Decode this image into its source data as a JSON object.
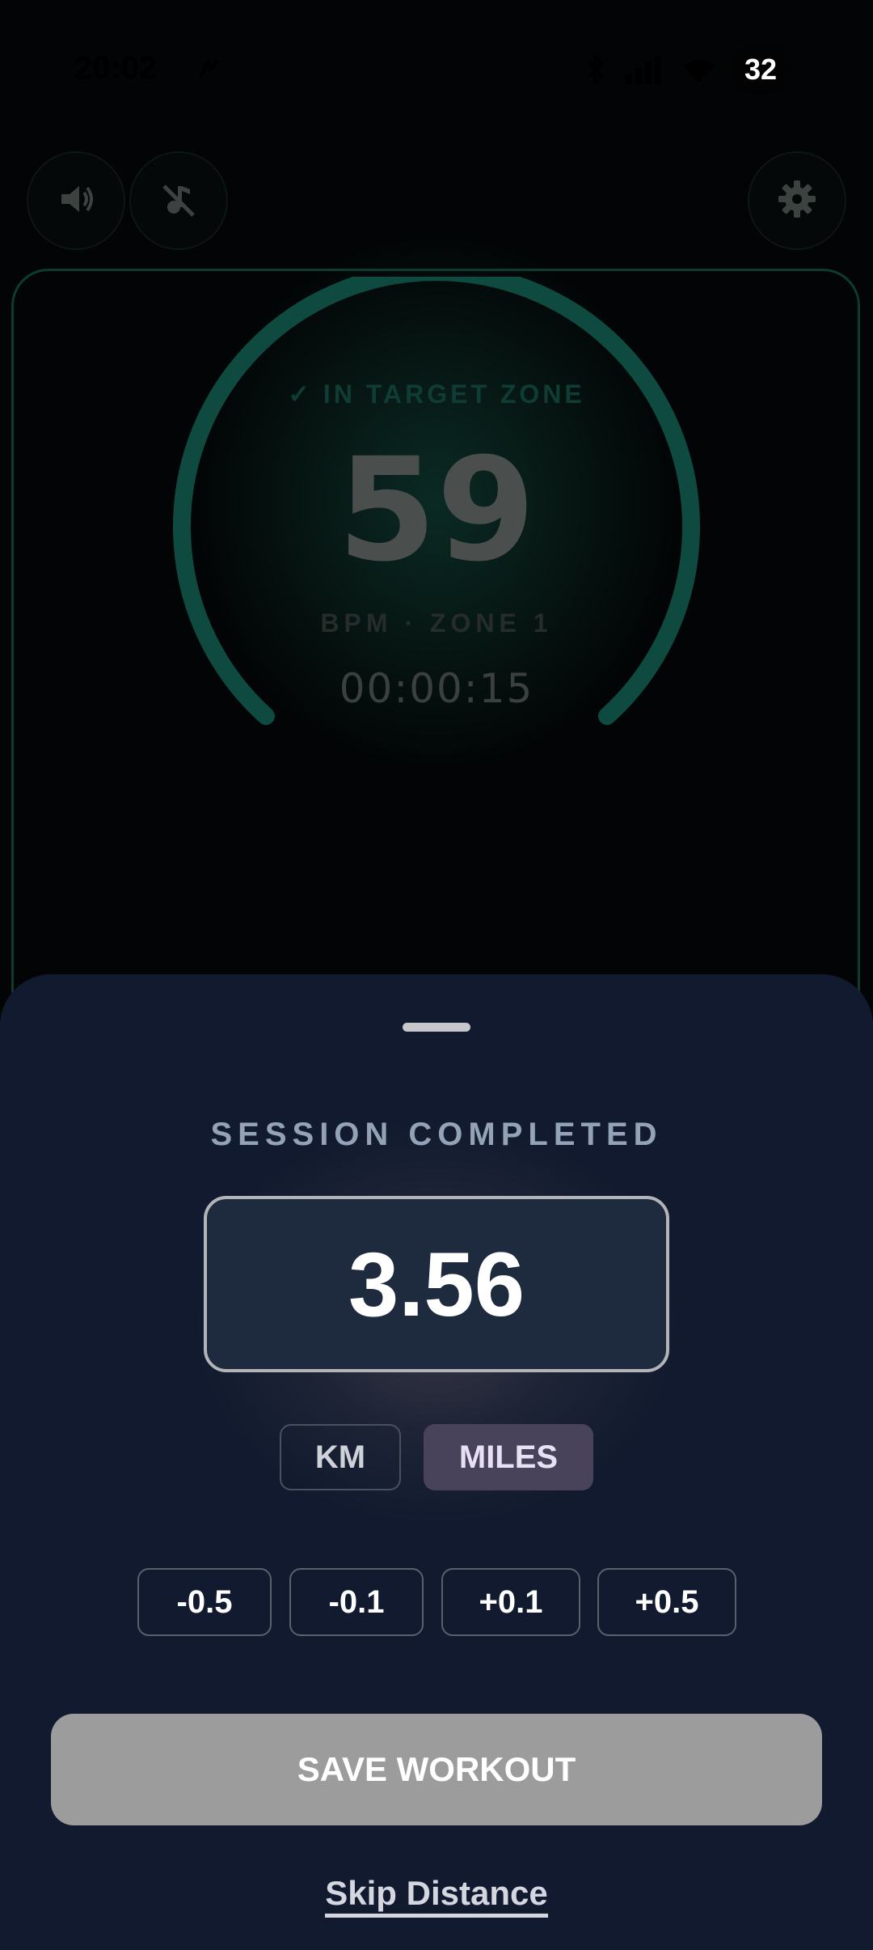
{
  "status_bar": {
    "time": "20:02",
    "battery": "32"
  },
  "icons": {
    "sound": "speaker-icon",
    "music_off": "music-off-icon",
    "settings": "gear-icon"
  },
  "heart_rate": {
    "target_zone_label": "✓ IN TARGET ZONE",
    "bpm": "59",
    "zone_label": "BPM · ZONE 1",
    "elapsed": "00:00:15"
  },
  "sheet": {
    "title": "SESSION COMPLETED",
    "distance": "3.56",
    "units": [
      "KM",
      "MILES"
    ],
    "selected_unit": "MILES",
    "adjustments": [
      "-0.5",
      "-0.1",
      "+0.1",
      "+0.5"
    ],
    "save_label": "SAVE WORKOUT",
    "skip_label": "Skip Distance"
  },
  "colors": {
    "sheet_background": "#111a2e",
    "gauge_arc": "#0f4a40",
    "save_button": "#9c9c9c",
    "selected_unit_bg": "#48435a"
  }
}
